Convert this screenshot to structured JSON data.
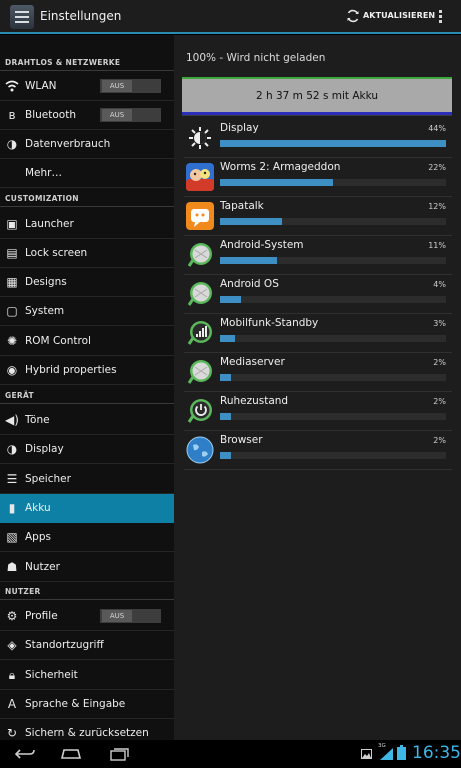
{
  "action_bar": {
    "title": "Einstellungen",
    "refresh_label": "AKTUALISIEREN",
    "icon": "settings-app-icon"
  },
  "sidebar": {
    "toggle_off": "AUS",
    "sections": [
      {
        "header": "DRAHTLOS & NETZWERKE",
        "items": [
          {
            "label": "WLAN",
            "icon": "wifi-icon",
            "toggle": "AUS"
          },
          {
            "label": "Bluetooth",
            "icon": "bluetooth-icon",
            "toggle": "AUS"
          },
          {
            "label": "Datenverbrauch",
            "icon": "data-usage-icon"
          },
          {
            "label": "Mehr…"
          }
        ]
      },
      {
        "header": "CUSTOMIZATION",
        "items": [
          {
            "label": "Launcher",
            "icon": "launcher-icon"
          },
          {
            "label": "Lock screen",
            "icon": "lock-screen-icon"
          },
          {
            "label": "Designs",
            "icon": "designs-icon"
          },
          {
            "label": "System",
            "icon": "system-icon"
          },
          {
            "label": "ROM Control",
            "icon": "rom-control-icon"
          },
          {
            "label": "Hybrid properties",
            "icon": "hybrid-icon"
          }
        ]
      },
      {
        "header": "GERÄT",
        "items": [
          {
            "label": "Töne",
            "icon": "sound-icon"
          },
          {
            "label": "Display",
            "icon": "display-icon"
          },
          {
            "label": "Speicher",
            "icon": "storage-icon"
          },
          {
            "label": "Akku",
            "icon": "battery-icon",
            "selected": true
          },
          {
            "label": "Apps",
            "icon": "apps-icon"
          },
          {
            "label": "Nutzer",
            "icon": "user-icon"
          }
        ]
      },
      {
        "header": "NUTZER",
        "items": [
          {
            "label": "Profile",
            "icon": "profile-icon",
            "toggle": "AUS"
          },
          {
            "label": "Standortzugriff",
            "icon": "location-icon"
          },
          {
            "label": "Sicherheit",
            "icon": "security-icon"
          },
          {
            "label": "Sprache & Eingabe",
            "icon": "language-icon"
          },
          {
            "label": "Sichern & zurücksetzen",
            "icon": "backup-icon"
          }
        ]
      }
    ]
  },
  "battery": {
    "status": "100% - Wird nicht geladen",
    "duration": "2 h 37 m 52 s mit Akku",
    "items": [
      {
        "name": "Display",
        "percent": "44%",
        "value": 44,
        "icon": "display-brightness-icon"
      },
      {
        "name": "Worms 2: Armageddon",
        "percent": "22%",
        "value": 22,
        "icon": "worms-app-icon"
      },
      {
        "name": "Tapatalk",
        "percent": "12%",
        "value": 12,
        "icon": "tapatalk-app-icon"
      },
      {
        "name": "Android-System",
        "percent": "11%",
        "value": 11,
        "icon": "android-system-icon"
      },
      {
        "name": "Android OS",
        "percent": "4%",
        "value": 4,
        "icon": "android-os-icon"
      },
      {
        "name": "Mobilfunk-Standby",
        "percent": "3%",
        "value": 3,
        "icon": "cell-standby-icon"
      },
      {
        "name": "Mediaserver",
        "percent": "2%",
        "value": 2,
        "icon": "mediaserver-icon"
      },
      {
        "name": "Ruhezustand",
        "percent": "2%",
        "value": 2,
        "icon": "idle-power-icon"
      },
      {
        "name": "Browser",
        "percent": "2%",
        "value": 2,
        "icon": "browser-globe-icon"
      }
    ]
  },
  "status_bar": {
    "network": "3G",
    "time": "16:35"
  },
  "colors": {
    "accent": "#0e7fa5",
    "bar": "#3e8fc3",
    "clock": "#3eb6e6"
  }
}
